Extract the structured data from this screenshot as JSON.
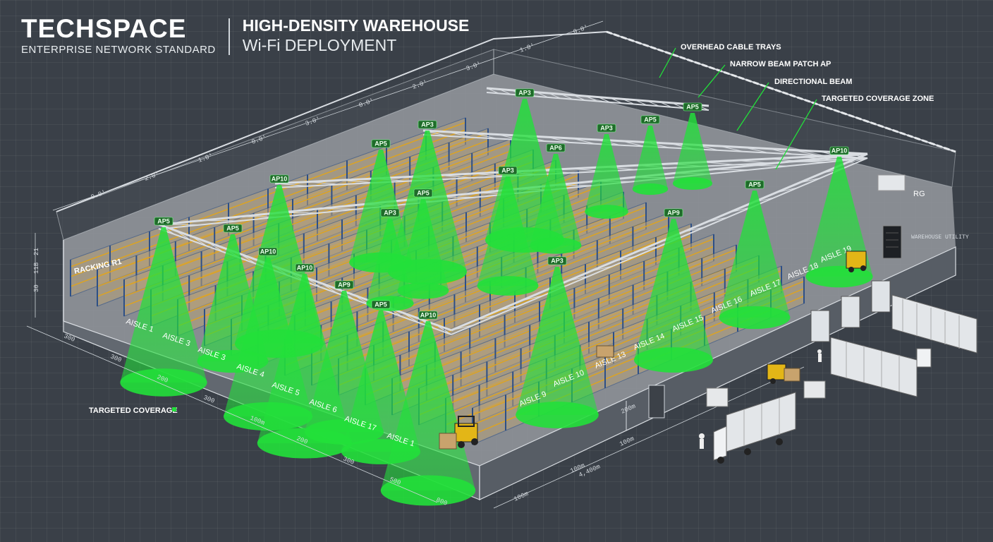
{
  "brand": {
    "name": "TECHSPACE",
    "tagline": "ENTERPRISE NETWORK STANDARD"
  },
  "title": {
    "line1": "HIGH-DENSITY WAREHOUSE",
    "line2": "Wi-Fi DEPLOYMENT"
  },
  "callouts": {
    "cable_trays": "OVERHEAD CABLE TRAYS",
    "patch_ap": "NARROW BEAM PATCH AP",
    "directional_beam": "DIRECTIONAL BEAM",
    "targeted_zone": "TARGETED COVERAGE ZONE",
    "targeted_coverage": "TARGETED COVERAGE"
  },
  "zone_labels": {
    "racking": "RACKING R1",
    "rg": "RG",
    "utility": "WAREHOUSE UTILITY"
  },
  "aisles": [
    "AISLE 1",
    "AISLE 3",
    "AISLE 3",
    "AISLE 4",
    "AISLE 5",
    "AISLE 6",
    "AISLE 17",
    "AISLE 1",
    "AISLE 9",
    "AISLE 10",
    "AISLE 13",
    "AISLE 14",
    "AISLE 15",
    "AISLE 16",
    "AISLE 17",
    "AISLE 18",
    "AISLE 19"
  ],
  "access_points": [
    "AP5",
    "AP10",
    "AP5",
    "AP3",
    "AP3",
    "AP5",
    "AP6",
    "AP3",
    "AP5",
    "AP3",
    "AP10",
    "AP10",
    "AP9",
    "AP5",
    "AP10",
    "AP3",
    "AP9",
    "AP5",
    "AP10",
    "AP5",
    "AP3",
    "AP5"
  ],
  "dimensions": {
    "top": [
      "0.0'",
      "2.0'",
      "1.0'",
      "0.0'",
      "3.0'",
      "0.0'",
      "2.0'",
      "3.0'",
      "1.0'",
      "0.0'"
    ],
    "left": [
      "300",
      "300",
      "200",
      "300",
      "100m",
      "200",
      "300",
      "500",
      "800"
    ],
    "right": [
      "200m",
      "100m",
      "100m",
      "4,400m",
      "100m"
    ],
    "height": [
      "21",
      "11B",
      "30"
    ]
  },
  "colors": {
    "background": "#3a4048",
    "coverage": "#22e03a",
    "steel": "#d9dde2",
    "rack_blue": "#2d4f86",
    "rack_beam": "#e0a41c",
    "floor": "#8f9399"
  },
  "icons": [
    "forklift-icon",
    "truck-icon",
    "container-icon",
    "server-rack-icon",
    "worker-icon"
  ]
}
